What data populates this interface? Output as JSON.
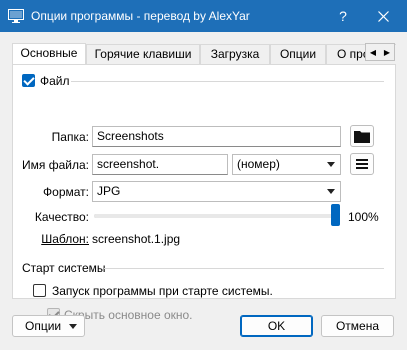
{
  "window": {
    "title": "Опции программы - перевод by AlexYar",
    "help_label": "?",
    "colors": {
      "titlebar": "#1e6fb8",
      "accent": "#0067c0"
    }
  },
  "tabs": [
    {
      "label": "Основные",
      "active": true
    },
    {
      "label": "Горячие клавиши",
      "active": false
    },
    {
      "label": "Загрузка",
      "active": false
    },
    {
      "label": "Опции",
      "active": false
    },
    {
      "label": "О программе",
      "active": false
    }
  ],
  "file_section": {
    "checkbox_label": "Файл",
    "checked": true,
    "folder_label": "Папка:",
    "folder_value": "Screenshots",
    "folder_button_icon": "folder-icon",
    "filename_label": "Имя файла:",
    "filename_value": "screenshot.",
    "filename_suffix_value": "(номер)",
    "filename_menu_icon": "hamburger-menu-icon",
    "format_label": "Формат:",
    "format_value": "JPG",
    "quality_label": "Качество:",
    "quality_value": "100%",
    "quality_fraction": 1.0,
    "template_label": "Шаблон:",
    "template_value": "screenshot.1.jpg"
  },
  "startup_section": {
    "title": "Старт системы",
    "launch_label": "Запуск программы при старте системы.",
    "launch_checked": false,
    "hide_label": "Скрыть основное окно.",
    "hide_checked": true,
    "hide_disabled": true
  },
  "footer": {
    "options_label": "Опции",
    "ok_label": "OK",
    "cancel_label": "Отмена"
  }
}
